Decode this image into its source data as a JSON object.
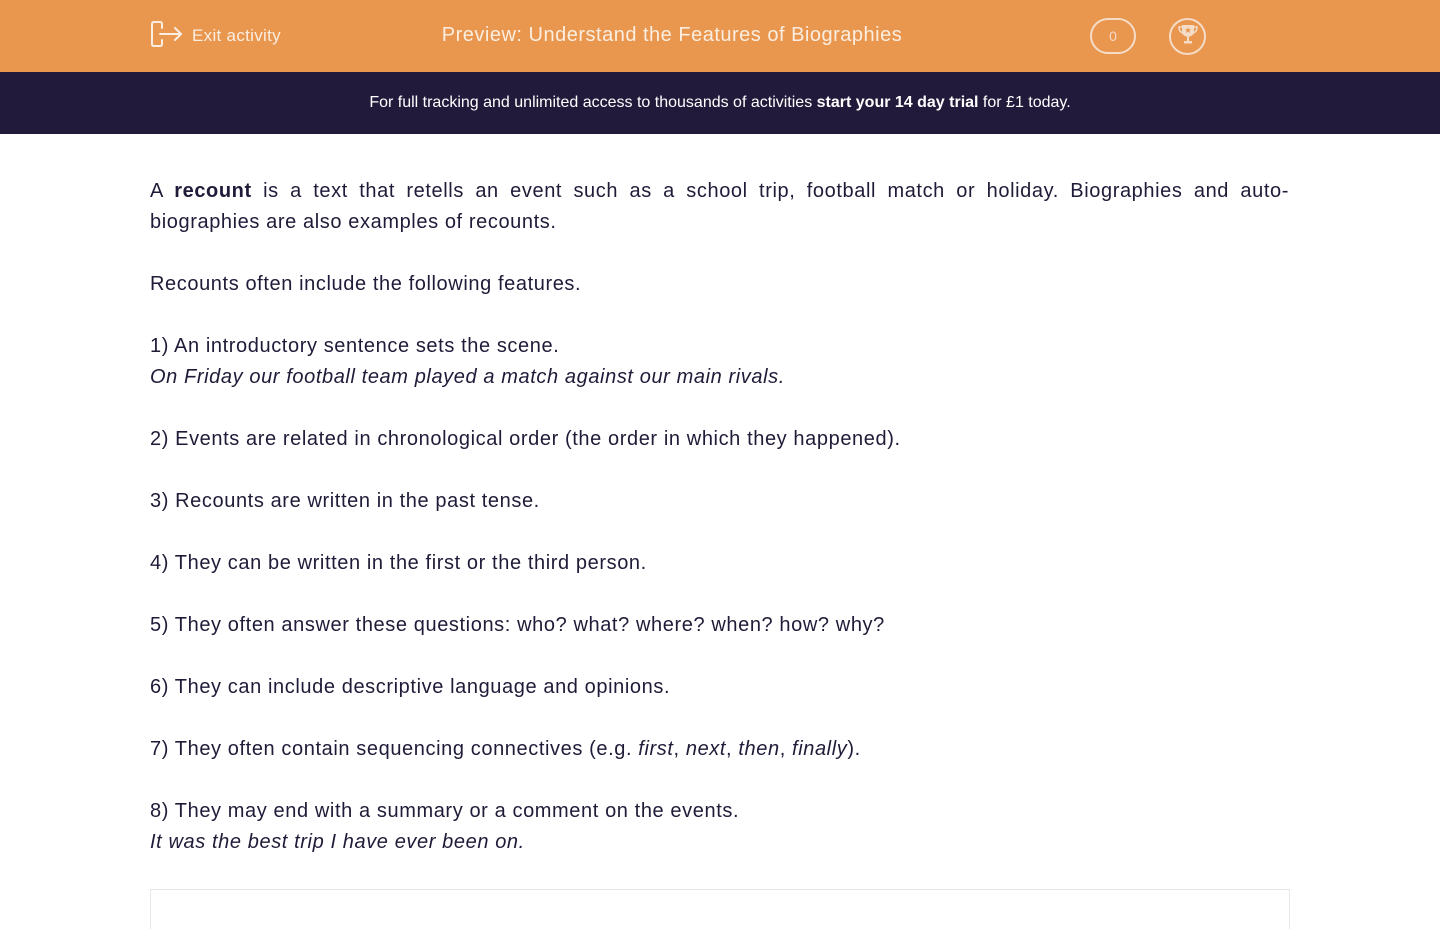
{
  "header": {
    "exit_label": "Exit activity",
    "title": "Preview: Understand the Features of Biographies",
    "score": "0",
    "icons": {
      "exit": "exit-icon",
      "trophy": "trophy-icon"
    },
    "colors": {
      "header_bg": "#e9964f",
      "banner_bg": "#221a3a",
      "text": "#1f1b38"
    }
  },
  "banner": {
    "text_before": "For full tracking and unlimited access to thousands of activities ",
    "cta": "start your 14 day trial",
    "text_after": " for £1 today."
  },
  "content": {
    "intro": {
      "before": "A ",
      "bold": "recount",
      "after": " is a text that retells an event such as a school trip, football match or holiday. Biographies and auto-biographies are also examples of recounts."
    },
    "lead": "Recounts often include the following features.",
    "features": [
      {
        "text": "1) An introductory sentence sets the scene.",
        "example": "On Friday our football team played a match against our main rivals."
      },
      {
        "text": "2) Events are related in chronological order (the order in which they happened)."
      },
      {
        "text": "3) Recounts are written in the past tense."
      },
      {
        "text": "4) They can be written in the first or the third person."
      },
      {
        "text": "5) They often answer these questions: who? what? where? when? how? why?"
      },
      {
        "text": "6) They can include descriptive language and opinions."
      },
      {
        "text_before": "7) They often contain sequencing connectives (e.g. ",
        "examples": [
          "first",
          "next",
          "then",
          "finally"
        ],
        "separator": ", ",
        "text_after": ")."
      },
      {
        "text": "8) They may end with a summary or a comment on the events.",
        "example": "It was the best trip I have ever been on."
      }
    ]
  }
}
